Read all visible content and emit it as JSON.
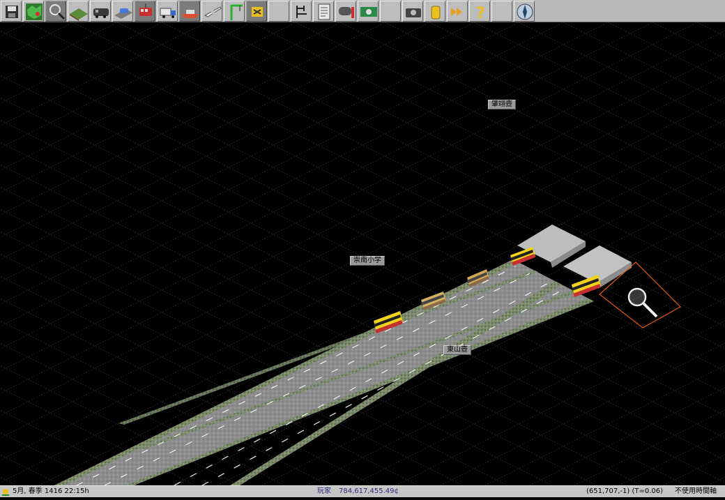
{
  "toolbar": {
    "icons": [
      "save-disk-icon",
      "map-icon",
      "magnifier-icon",
      "terrain-icon",
      "railway-icon",
      "road-icon",
      "tram-icon",
      "truck-icon",
      "ship-icon",
      "airplane-icon",
      "crane-icon",
      "special-tools-icon",
      "schedule-icon",
      "list-icon",
      "mailbox-icon",
      "finance-icon",
      "camera-icon",
      "coin-icon",
      "fast-forward-icon",
      "help-icon",
      "compass-icon"
    ]
  },
  "map": {
    "town_labels": [
      "肇翊壺",
      "崇南小学",
      "東山壺"
    ]
  },
  "status": {
    "date": "5月, 春季 1416 22:15h",
    "player": "玩家",
    "money": "784,617,455.49¢",
    "coords": "(651,707,-1) (T=0.06)",
    "mode": "不使用時間軸"
  },
  "colors": {
    "money": "#2a2a7a",
    "player": "#2a2a7a"
  }
}
